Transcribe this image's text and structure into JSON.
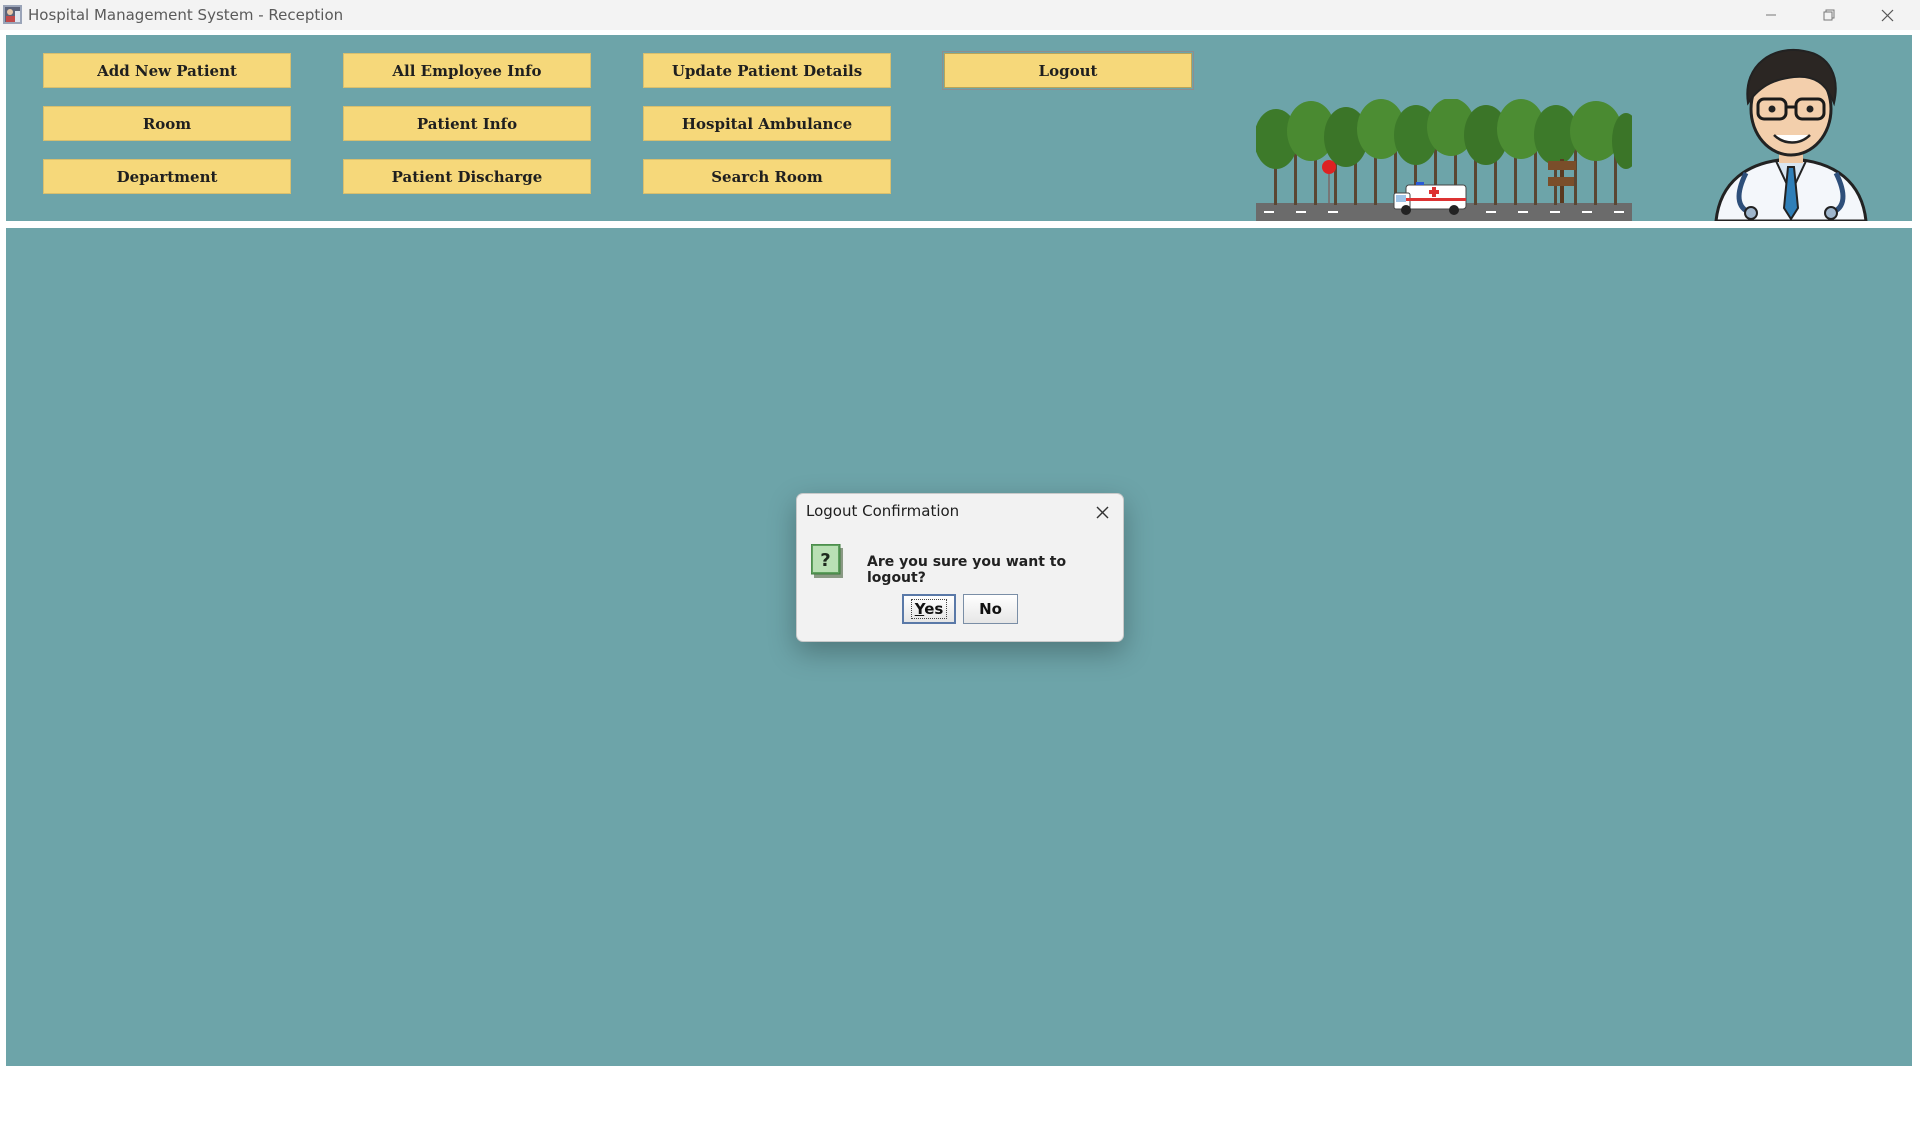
{
  "window": {
    "title": "Hospital Management System - Reception",
    "icons": [
      "app-icon",
      "minimize-icon",
      "restore-icon",
      "close-icon"
    ]
  },
  "nav": {
    "add_new_patient": "Add New Patient",
    "all_employee_info": "All Employee Info",
    "update_patient_details": "Update Patient Details",
    "logout": "Logout",
    "room": "Room",
    "patient_info": "Patient Info",
    "hospital_ambulance": "Hospital Ambulance",
    "department": "Department",
    "patient_discharge": "Patient Discharge",
    "search_room": "Search Room"
  },
  "dialog": {
    "title": "Logout Confirmation",
    "message": "Are you sure you want to logout?",
    "yes_rest": "es",
    "yes_mnemonic": "Y",
    "no_label": "No",
    "icon": "question-icon"
  },
  "colors": {
    "panel_bg": "#6da4a9",
    "button_bg": "#f6d87a",
    "dialog_bg": "#f2f2f2"
  }
}
